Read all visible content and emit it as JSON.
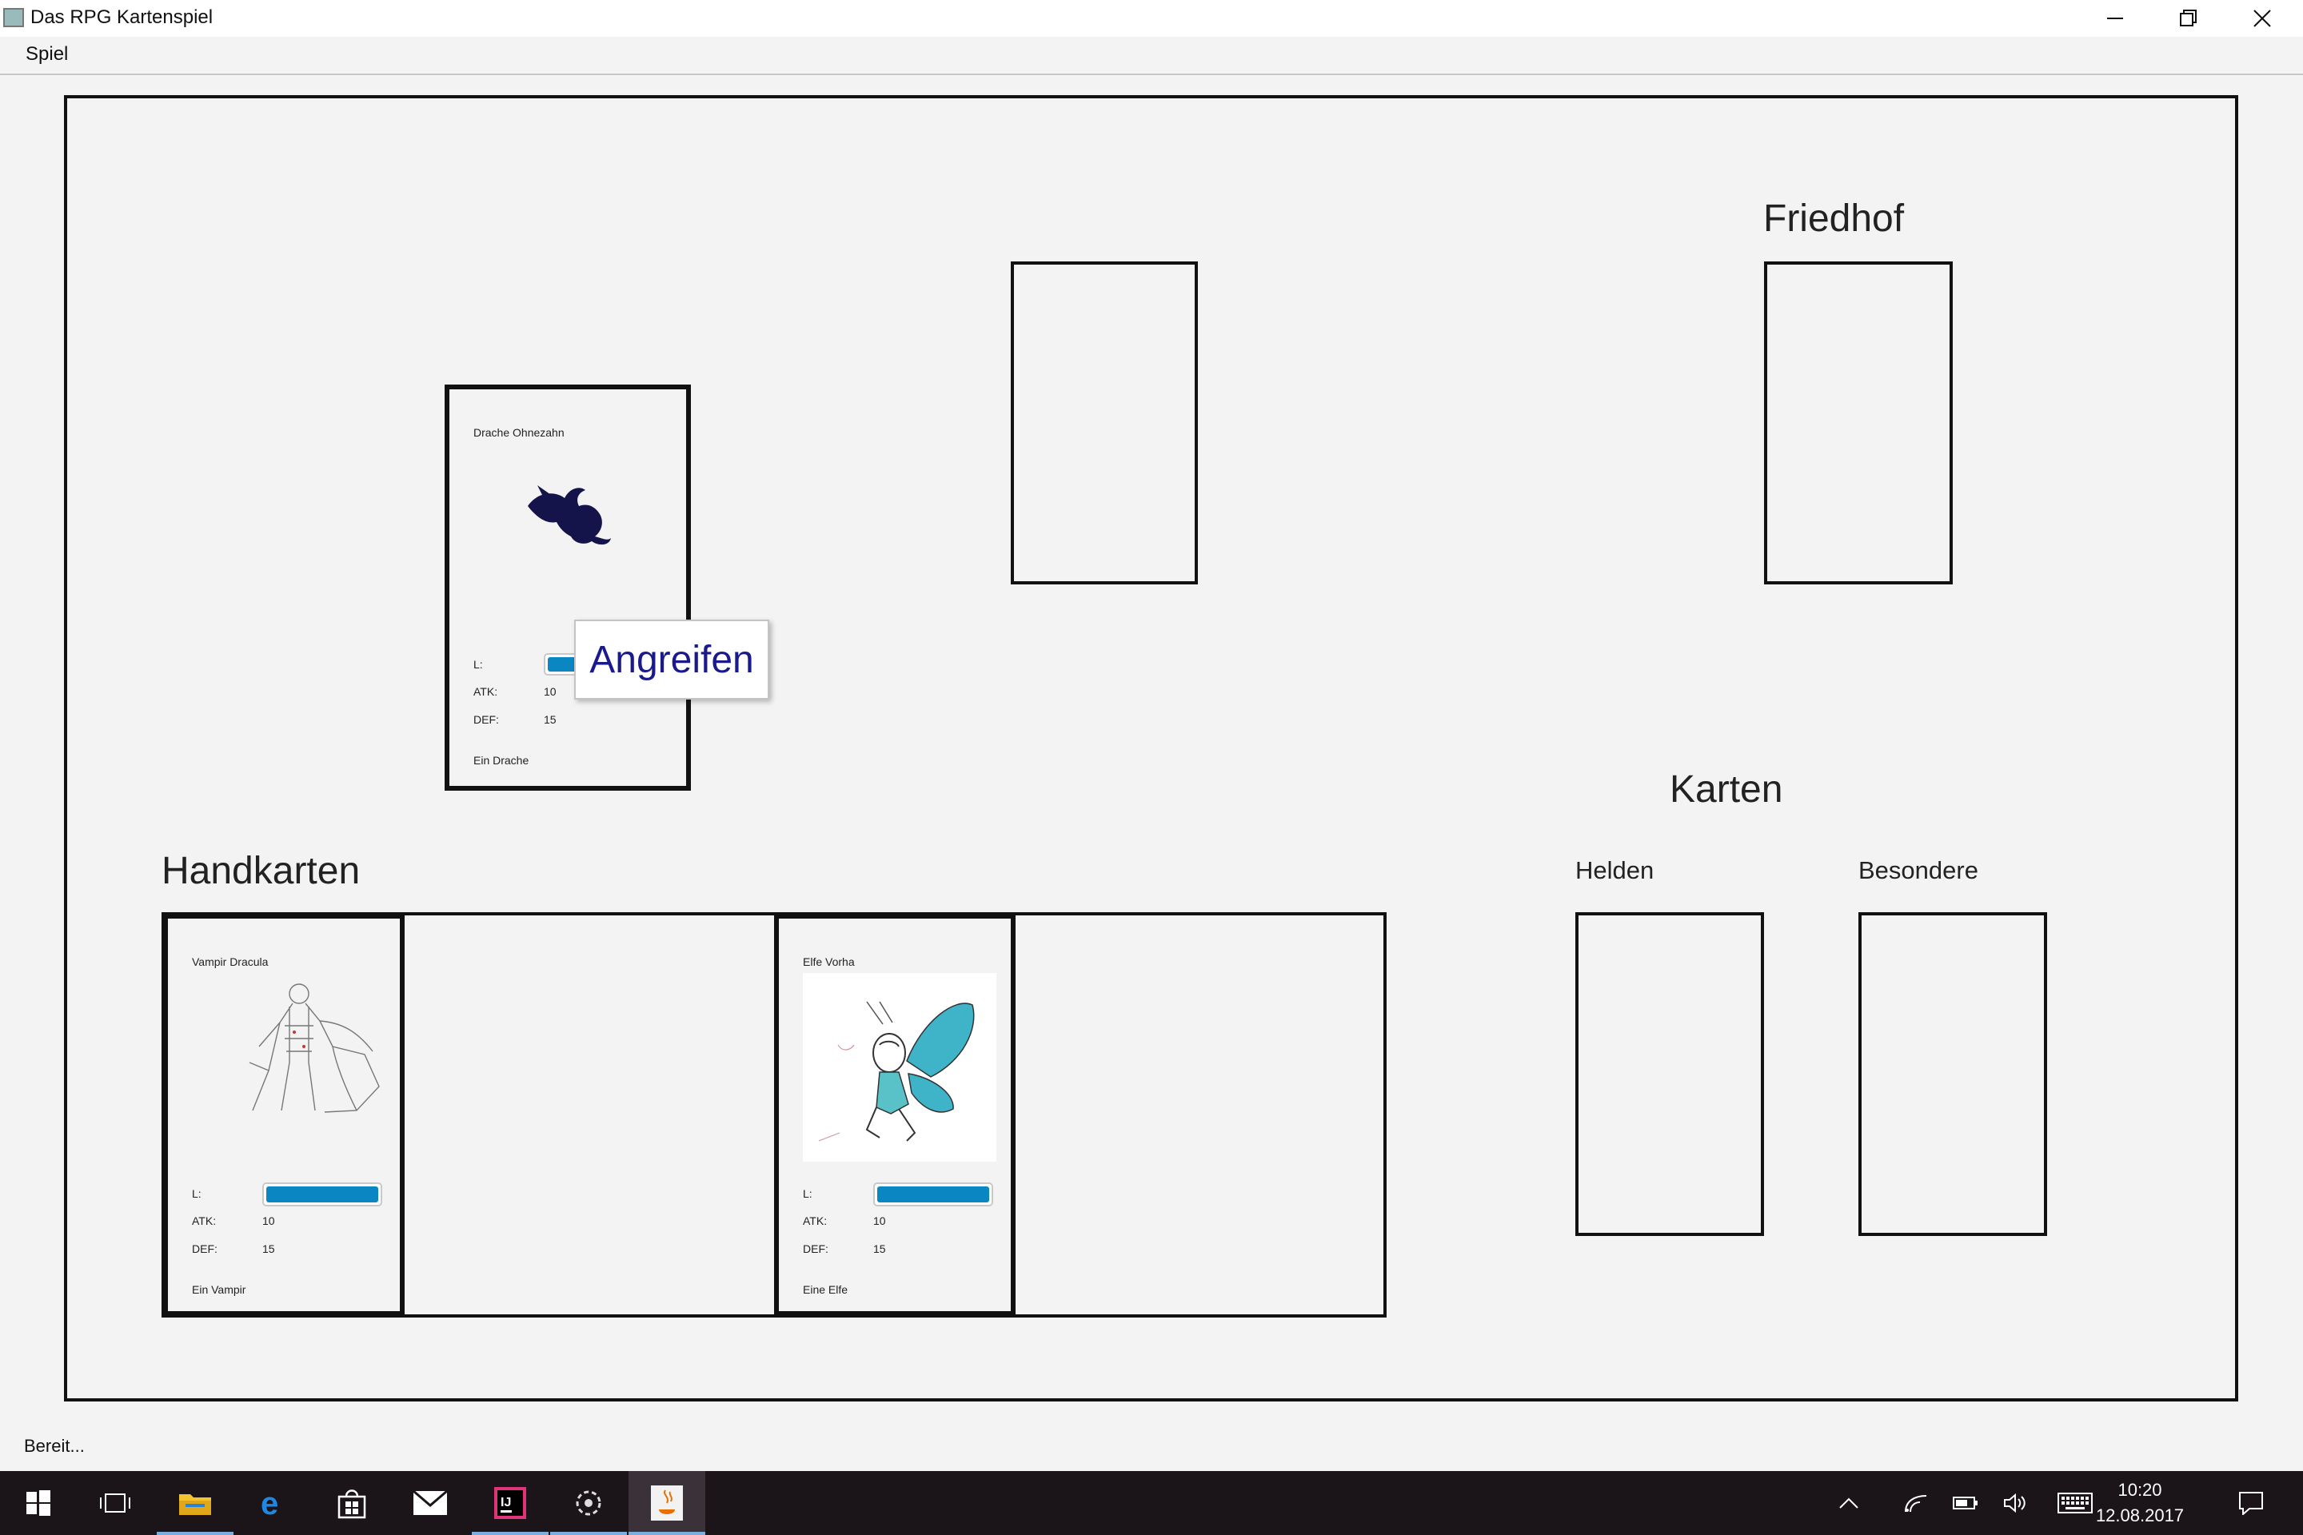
{
  "window": {
    "title": "Das RPG Kartenspiel",
    "controls": [
      "minimize",
      "restore",
      "close"
    ]
  },
  "menu": {
    "items": [
      "Spiel"
    ]
  },
  "board": {
    "friedhof_label": "Friedhof",
    "karten_label": "Karten",
    "helden_label": "Helden",
    "besondere_label": "Besondere",
    "handkarten_label": "Handkarten"
  },
  "field_card": {
    "name": "Drache Ohnezahn",
    "life_label": "L:",
    "atk_label": "ATK:",
    "atk_value": "10",
    "def_label": "DEF:",
    "def_value": "15",
    "description": "Ein Drache",
    "life_fraction": 1.0,
    "image_icon": "dragon-silhouette-icon"
  },
  "context_menu": {
    "attack_label": "Angreifen"
  },
  "hand_cards": [
    {
      "name": "Vampir Dracula",
      "life_label": "L:",
      "atk_label": "ATK:",
      "atk_value": "10",
      "def_label": "DEF:",
      "def_value": "15",
      "description": "Ein Vampir",
      "life_fraction": 1.0,
      "image_icon": "vampire-sketch-icon"
    },
    {
      "name": "Elfe Vorha",
      "life_label": "L:",
      "atk_label": "ATK:",
      "atk_value": "10",
      "def_label": "DEF:",
      "def_value": "15",
      "description": "Eine Elfe",
      "life_fraction": 1.0,
      "image_icon": "fairy-drawing-icon"
    }
  ],
  "status": {
    "text": "Bereit..."
  },
  "taskbar": {
    "apps": [
      "windows-start-icon",
      "task-view-icon",
      "file-explorer-icon",
      "edge-icon",
      "store-icon",
      "mail-icon",
      "intellij-icon",
      "app-icon",
      "java-icon"
    ],
    "tray": [
      "chevron-up-icon",
      "wifi-icon",
      "battery-icon",
      "volume-icon",
      "keyboard-icon",
      "notification-icon"
    ],
    "time": "10:20",
    "date": "12.08.2017"
  },
  "colors": {
    "life_bar": "#0a86c2",
    "taskbar": "#1b1419",
    "tooltip_text": "#1a1a8c",
    "border": "#111111"
  }
}
